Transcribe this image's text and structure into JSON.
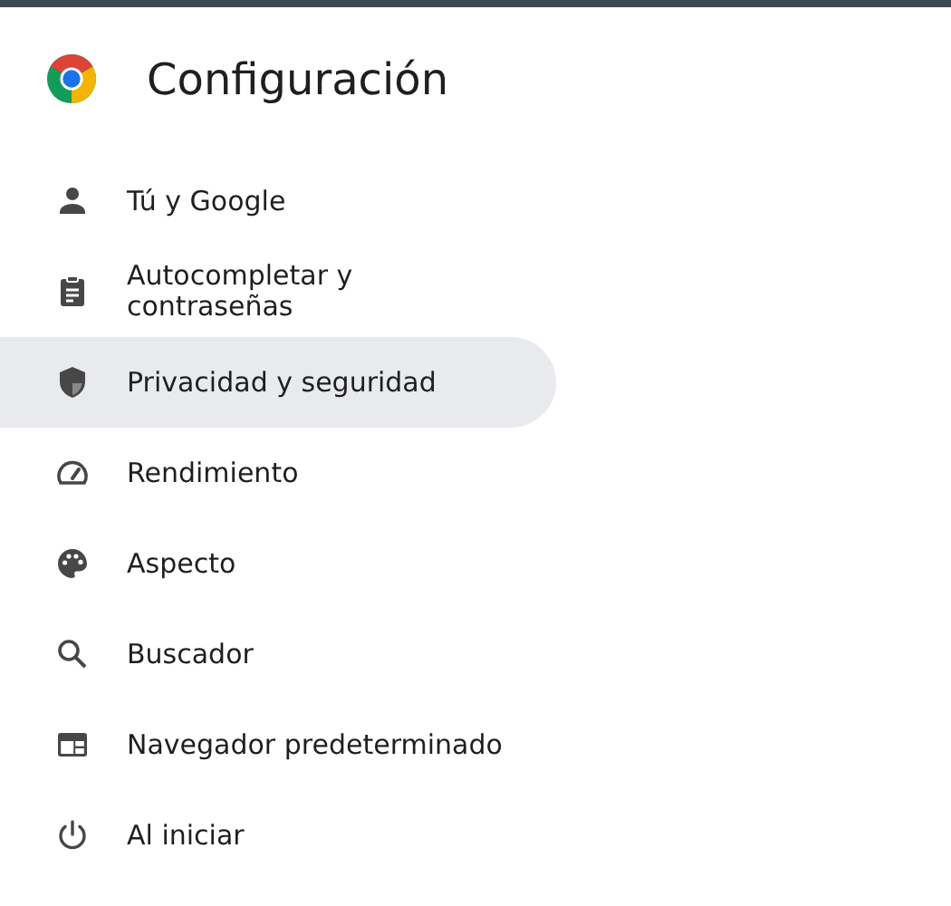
{
  "header": {
    "title": "Configuración"
  },
  "sidebar": {
    "items": [
      {
        "label": "Tú y Google",
        "selected": false
      },
      {
        "label": "Autocompletar y contraseñas",
        "selected": false
      },
      {
        "label": "Privacidad y seguridad",
        "selected": true
      },
      {
        "label": "Rendimiento",
        "selected": false
      },
      {
        "label": "Aspecto",
        "selected": false
      },
      {
        "label": "Buscador",
        "selected": false
      },
      {
        "label": "Navegador predeterminado",
        "selected": false
      },
      {
        "label": "Al iniciar",
        "selected": false
      }
    ]
  }
}
